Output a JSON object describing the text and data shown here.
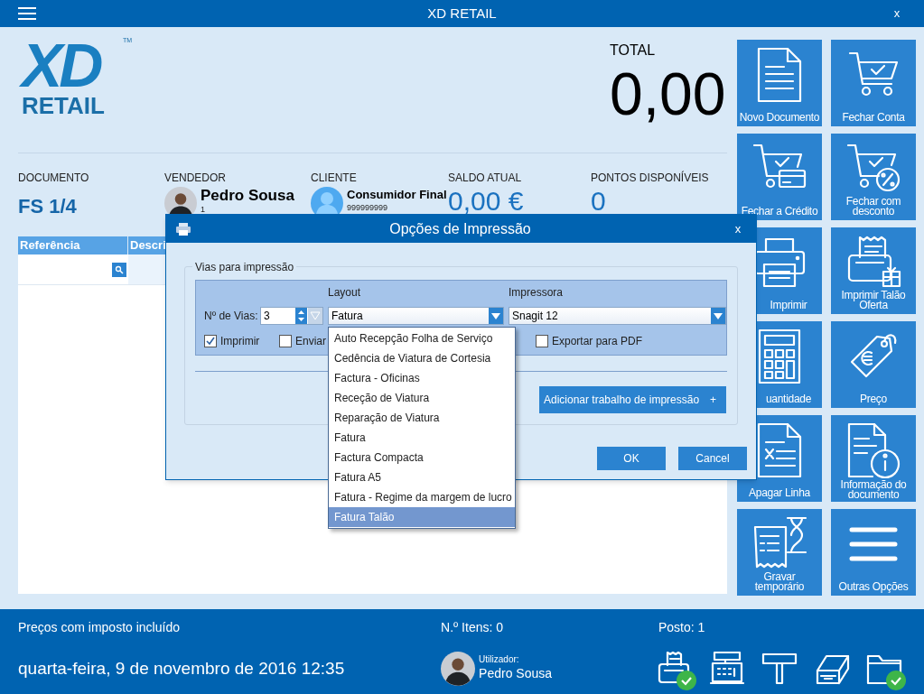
{
  "window": {
    "title": "XD RETAIL",
    "close": "x"
  },
  "logo": {
    "mark": "XD",
    "trademark": "TM",
    "name": "RETAIL"
  },
  "total": {
    "label": "TOTAL",
    "value": "0,00"
  },
  "info": [
    {
      "kind": "plain",
      "label": "DOCUMENTO",
      "value": "FS 1/4"
    },
    {
      "kind": "person",
      "label": "VENDEDOR",
      "name": "Pedro Sousa",
      "detail": "1"
    },
    {
      "kind": "client",
      "label": "CLIENTE",
      "name": "Consumidor Final",
      "detail": "999999999"
    },
    {
      "kind": "plain",
      "label": "SALDO ATUAL",
      "value": "0,00 €"
    },
    {
      "kind": "plain",
      "label": "PONTOS DISPONÍVEIS",
      "value": "0"
    }
  ],
  "table": {
    "columns": [
      "Referência",
      "Descri"
    ]
  },
  "tiles": [
    {
      "kind": "document",
      "label": "Novo Documento"
    },
    {
      "kind": "cart-check",
      "label": "Fechar Conta"
    },
    {
      "kind": "cart-card",
      "label": "Fechar a Crédito"
    },
    {
      "kind": "cart-percent",
      "label": "Fechar com desconto"
    },
    {
      "kind": "printer",
      "label": "Imprimir"
    },
    {
      "kind": "receipt-gift",
      "label": "Imprimir Talão Oferta"
    },
    {
      "kind": "calculator",
      "label": "uantidade"
    },
    {
      "kind": "price-tag",
      "label": "Preço"
    },
    {
      "kind": "document-x",
      "label": "Apagar Linha"
    },
    {
      "kind": "document-info",
      "label": "Informação do documento"
    },
    {
      "kind": "receipt-hourglass",
      "label": "Gravar temporário"
    },
    {
      "kind": "menu",
      "label": "Outras Opções"
    }
  ],
  "dialog": {
    "title": "Opções de Impressão",
    "close": "x",
    "group_label": "Vias para impressão",
    "layout_label": "Layout",
    "printer_label": "Impressora",
    "copies_label": "Nº de Vias:",
    "copies": "3",
    "layout_value": "Fatura",
    "printer_value": "Snagit 12",
    "options": [
      {
        "label": "Imprimir",
        "checked": true
      },
      {
        "label": "Enviar",
        "checked": false
      },
      {
        "label": "Exportar para PDF",
        "checked": false
      }
    ],
    "add_button": "Adicionar trabalho de impressão",
    "add_icon": "+",
    "buttons": [
      "OK",
      "Cancel"
    ],
    "dropdown": [
      {
        "label": "Auto Recepção Folha de Serviço",
        "selected": false
      },
      {
        "label": "Cedência de Viatura de Cortesia",
        "selected": false
      },
      {
        "label": "Factura - Oficinas",
        "selected": false
      },
      {
        "label": "Receção de Viatura",
        "selected": false
      },
      {
        "label": "Reparação de Viatura",
        "selected": false
      },
      {
        "label": "Fatura",
        "selected": false
      },
      {
        "label": "Factura Compacta",
        "selected": false
      },
      {
        "label": "Fatura A5",
        "selected": false
      },
      {
        "label": "Fatura - Regime da margem de lucro",
        "selected": false
      },
      {
        "label": "Fatura Talão",
        "selected": true
      }
    ]
  },
  "status_bar": {
    "tax_note": "Preços com imposto incluído",
    "items_count": "N.º Itens: 0",
    "post": "Posto: 1",
    "date": "quarta-feira, 9 de novembro de 2016 12:35",
    "user_label": "Utilizador:",
    "user_name": "Pedro Sousa",
    "devices": [
      {
        "kind": "receipt-printer",
        "ok": true
      },
      {
        "kind": "cash-register",
        "ok": false
      },
      {
        "kind": "pole-display",
        "ok": false
      },
      {
        "kind": "cash-drawer",
        "ok": false
      },
      {
        "kind": "folder",
        "ok": true
      }
    ]
  }
}
